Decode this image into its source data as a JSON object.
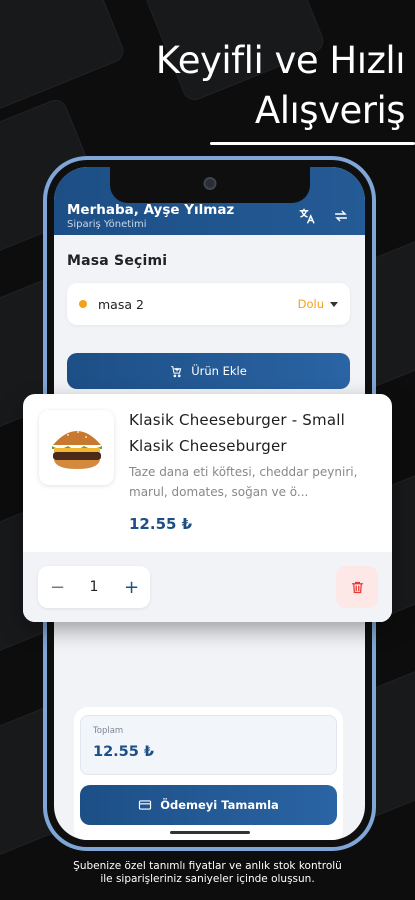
{
  "headline": {
    "line1": "Keyifli ve Hızlı",
    "line2": "Alışveriş"
  },
  "header": {
    "greeting": "Merhaba, Ayşe Yılmaz",
    "subtitle": "Sipariş Yönetimi"
  },
  "table_section": {
    "title": "Masa Seçimi",
    "selected_table": "masa 2",
    "status": "Dolu",
    "status_color": "#f4a21a"
  },
  "add_product_label": "Ürün Ekle",
  "product": {
    "title": "Klasik Cheeseburger - Small",
    "subtitle": "Klasik Cheeseburger",
    "description": "Taze dana eti köftesi, cheddar peyniri, marul, domates, soğan ve ö...",
    "price": "12.55 ₺",
    "quantity": "1",
    "minus": "−",
    "plus": "+"
  },
  "summary": {
    "total_label": "Toplam",
    "total_value": "12.55 ₺",
    "pay_label": "Ödemeyi Tamamla"
  },
  "footer": {
    "line1": "Şubenize özel tanımlı fiyatlar ve anlık stok kontrolü",
    "line2": "ile siparişleriniz saniyeler içinde oluşsun."
  },
  "colors": {
    "primary": "#1d4f86",
    "accent": "#f4a21a",
    "danger": "#e53935"
  },
  "icons": {
    "translate": "translate-icon",
    "swap": "swap-icon",
    "add_cart": "cart-plus-icon",
    "card": "credit-card-icon",
    "trash": "trash-icon"
  }
}
